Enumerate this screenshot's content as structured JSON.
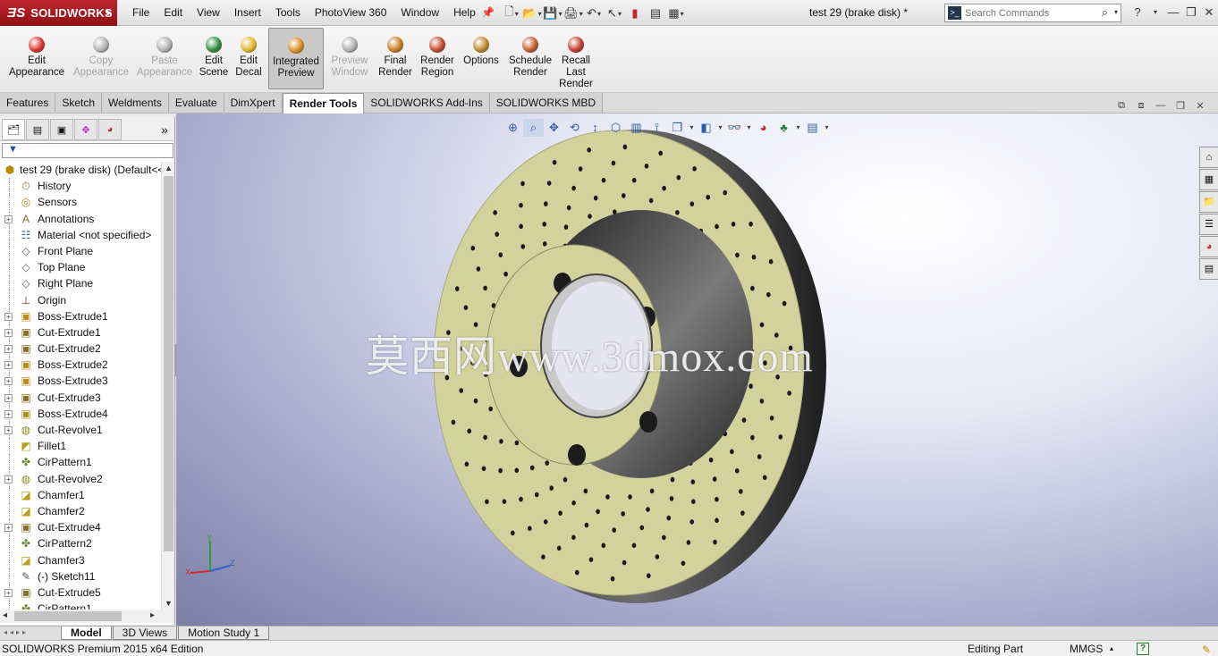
{
  "app": {
    "logo": "SOLIDWORKS",
    "document_title": "test 29 (brake disk) *"
  },
  "menu": [
    "File",
    "Edit",
    "View",
    "Insert",
    "Tools",
    "PhotoView 360",
    "Window",
    "Help"
  ],
  "search": {
    "placeholder": "Search Commands"
  },
  "commands": [
    {
      "label": "Edit Appearance",
      "state": "enabled",
      "color": "#d9332b"
    },
    {
      "label": "Copy Appearance",
      "state": "disabled",
      "color": "#b0b0b0"
    },
    {
      "label": "Paste Appearance",
      "state": "disabled",
      "color": "#b0b0b0"
    },
    {
      "label": "Edit Scene",
      "state": "enabled",
      "color": "#2d8a3e"
    },
    {
      "label": "Edit Decal",
      "state": "enabled",
      "color": "#e0b52a"
    },
    {
      "label": "Integrated Preview",
      "state": "active",
      "color": "#d68a22"
    },
    {
      "label": "Preview Window",
      "state": "disabled",
      "color": "#b0b0b0"
    },
    {
      "label": "Final Render",
      "state": "enabled",
      "color": "#c9791a"
    },
    {
      "label": "Render Region",
      "state": "enabled",
      "color": "#c0472a"
    },
    {
      "label": "Options",
      "state": "enabled",
      "color": "#b8862a"
    },
    {
      "label": "Schedule Render",
      "state": "enabled",
      "color": "#c25c2a"
    },
    {
      "label": "Recall Last Render",
      "state": "enabled",
      "color": "#c23a2a"
    }
  ],
  "tabs": [
    "Features",
    "Sketch",
    "Weldments",
    "Evaluate",
    "DimXpert",
    "Render Tools",
    "SOLIDWORKS Add-Ins",
    "SOLIDWORKS MBD"
  ],
  "active_tab": "Render Tools",
  "tree": {
    "root": "test 29 (brake disk)  (Default<<",
    "items": [
      {
        "label": "History",
        "icon": "history-icon",
        "expandable": false
      },
      {
        "label": "Sensors",
        "icon": "sensors-icon",
        "expandable": false
      },
      {
        "label": "Annotations",
        "icon": "annotations-icon",
        "expandable": true
      },
      {
        "label": "Material <not specified>",
        "icon": "material-icon",
        "expandable": false
      },
      {
        "label": "Front Plane",
        "icon": "plane-icon",
        "expandable": false
      },
      {
        "label": "Top Plane",
        "icon": "plane-icon",
        "expandable": false
      },
      {
        "label": "Right Plane",
        "icon": "plane-icon",
        "expandable": false
      },
      {
        "label": "Origin",
        "icon": "origin-icon",
        "expandable": false
      },
      {
        "label": "Boss-Extrude1",
        "icon": "boss-extrude-icon",
        "expandable": true
      },
      {
        "label": "Cut-Extrude1",
        "icon": "cut-extrude-icon",
        "expandable": true
      },
      {
        "label": "Cut-Extrude2",
        "icon": "cut-extrude-icon",
        "expandable": true
      },
      {
        "label": "Boss-Extrude2",
        "icon": "boss-extrude-icon",
        "expandable": true
      },
      {
        "label": "Boss-Extrude3",
        "icon": "boss-extrude-icon",
        "expandable": true
      },
      {
        "label": "Cut-Extrude3",
        "icon": "cut-extrude-icon",
        "expandable": true
      },
      {
        "label": "Boss-Extrude4",
        "icon": "boss-extrude-icon",
        "expandable": true
      },
      {
        "label": "Cut-Revolve1",
        "icon": "cut-revolve-icon",
        "expandable": true
      },
      {
        "label": "Fillet1",
        "icon": "fillet-icon",
        "expandable": false
      },
      {
        "label": "CirPattern1",
        "icon": "circular-pattern-icon",
        "expandable": false
      },
      {
        "label": "Cut-Revolve2",
        "icon": "cut-revolve-icon",
        "expandable": true
      },
      {
        "label": "Chamfer1",
        "icon": "chamfer-icon",
        "expandable": false
      },
      {
        "label": "Chamfer2",
        "icon": "chamfer-icon",
        "expandable": false
      },
      {
        "label": "Cut-Extrude4",
        "icon": "cut-extrude-icon",
        "expandable": true
      },
      {
        "label": "CirPattern2",
        "icon": "circular-pattern-icon",
        "expandable": false
      },
      {
        "label": "Chamfer3",
        "icon": "chamfer-icon",
        "expandable": false
      },
      {
        "label": "(-) Sketch11",
        "icon": "sketch-icon",
        "expandable": false
      },
      {
        "label": "Cut-Extrude5",
        "icon": "cut-extrude-icon",
        "expandable": true
      },
      {
        "label": "CirPattern1",
        "icon": "circular-pattern-icon",
        "expandable": false
      }
    ]
  },
  "watermark": "莫西网www.3dmox.com",
  "triad": {
    "x": "X",
    "y": "Y",
    "z": "Z"
  },
  "bottom_tabs": [
    "Model",
    "3D Views",
    "Motion Study 1"
  ],
  "active_bottom_tab": "Model",
  "status": {
    "left": "SOLIDWORKS Premium 2015 x64 Edition",
    "mode": "Editing Part",
    "units": "MMGS"
  },
  "colors": {
    "brand_red": "#b51c22",
    "disk_face": "#d2d39c",
    "active_tab_bg": "#ffffff"
  }
}
